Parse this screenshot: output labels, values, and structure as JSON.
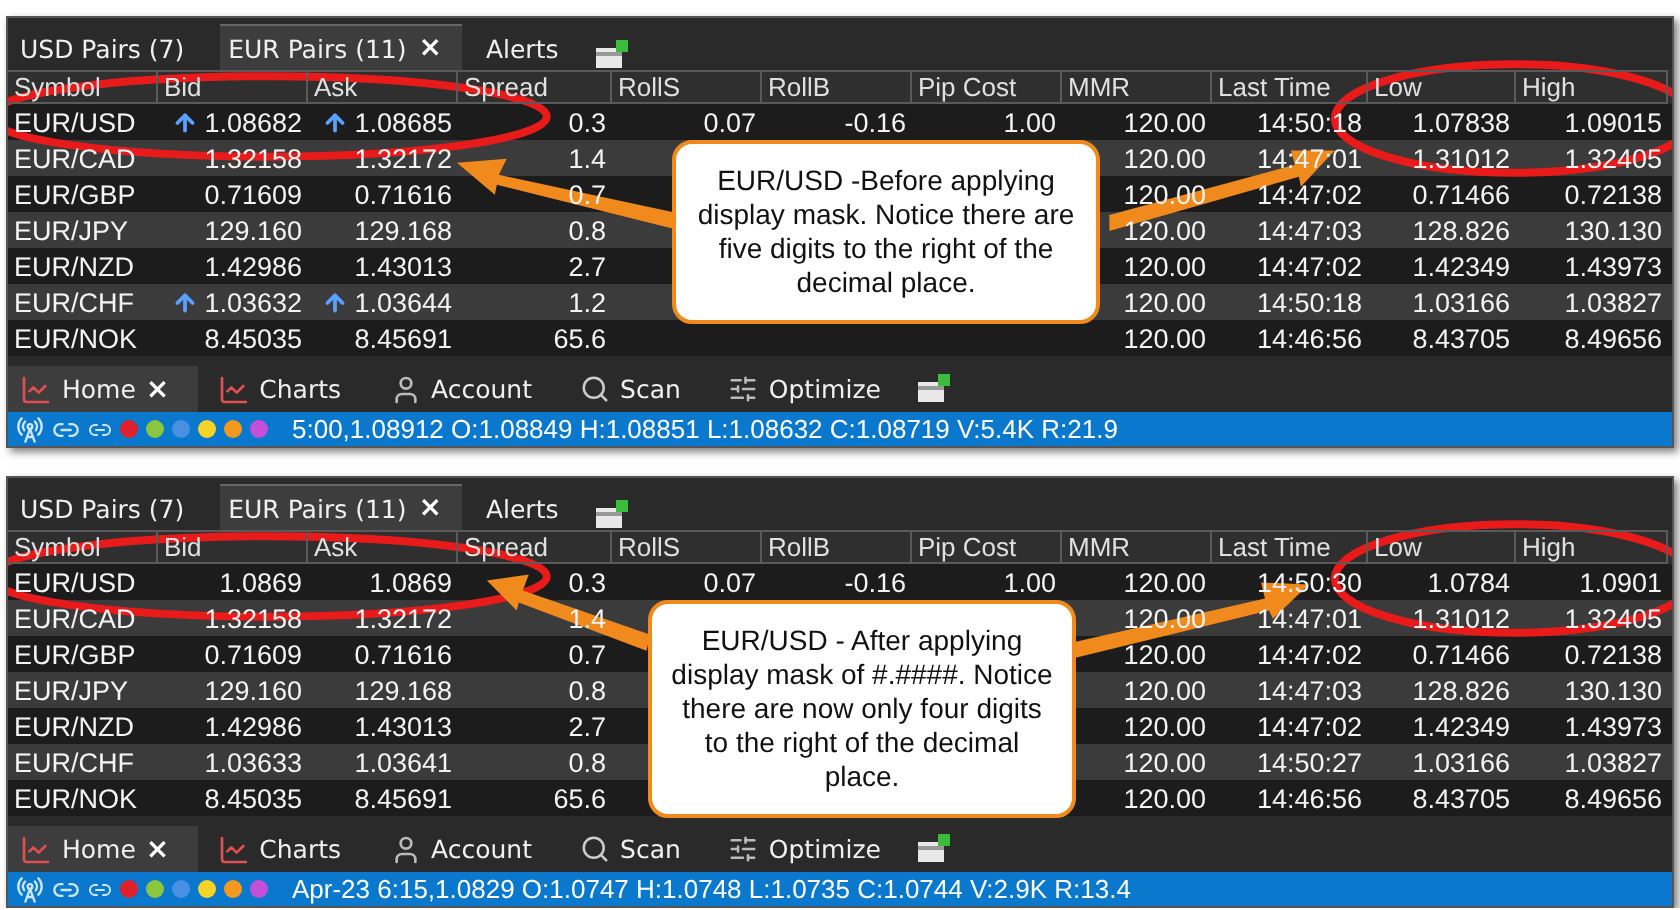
{
  "panels": [
    {
      "tabs": [
        {
          "label": "USD Pairs (7)",
          "selected": false
        },
        {
          "label": "EUR Pairs (11)",
          "selected": true,
          "close": "×"
        },
        {
          "label": "Alerts",
          "selected": false
        }
      ],
      "columns": [
        "Symbol",
        "Bid",
        "Ask",
        "Spread",
        "RollS",
        "RollB",
        "Pip Cost",
        "MMR",
        "Last Time",
        "Low",
        "High"
      ],
      "rows": [
        {
          "cells": [
            "EUR/USD",
            "1.08682",
            "1.08685",
            "0.3",
            "0.07",
            "-0.16",
            "1.00",
            "120.00",
            "14:50:18",
            "1.07838",
            "1.09015"
          ],
          "bid_up": true,
          "ask_up": true
        },
        {
          "cells": [
            "EUR/CAD",
            "1.32158",
            "1.32172",
            "1.4",
            null,
            null,
            null,
            "120.00",
            "14:47:01",
            "1.31012",
            "1.32405"
          ],
          "bid_up": false,
          "ask_up": false
        },
        {
          "cells": [
            "EUR/GBP",
            "0.71609",
            "0.71616",
            "0.7",
            null,
            null,
            null,
            "120.00",
            "14:47:02",
            "0.71466",
            "0.72138"
          ],
          "bid_up": false,
          "ask_up": false
        },
        {
          "cells": [
            "EUR/JPY",
            "129.160",
            "129.168",
            "0.8",
            null,
            null,
            null,
            "120.00",
            "14:47:03",
            "128.826",
            "130.130"
          ],
          "bid_up": false,
          "ask_up": false
        },
        {
          "cells": [
            "EUR/NZD",
            "1.42986",
            "1.43013",
            "2.7",
            null,
            null,
            null,
            "120.00",
            "14:47:02",
            "1.42349",
            "1.43973"
          ],
          "bid_up": false,
          "ask_up": false
        },
        {
          "cells": [
            "EUR/CHF",
            "1.03632",
            "1.03644",
            "1.2",
            null,
            null,
            null,
            "120.00",
            "14:50:18",
            "1.03166",
            "1.03827"
          ],
          "bid_up": true,
          "ask_up": true
        },
        {
          "cells": [
            "EUR/NOK",
            "8.45035",
            "8.45691",
            "65.6",
            null,
            null,
            null,
            "120.00",
            "14:46:56",
            "8.43705",
            "8.49656"
          ],
          "bid_up": false,
          "ask_up": false
        }
      ],
      "bottom_tabs": [
        {
          "label": "Home",
          "selected": true,
          "close": "×",
          "kind": "home"
        },
        {
          "label": "Charts",
          "selected": false,
          "kind": "charts"
        },
        {
          "label": "Account",
          "selected": false,
          "kind": "account"
        },
        {
          "label": "Scan",
          "selected": false,
          "kind": "scan"
        },
        {
          "label": "Optimize",
          "selected": false,
          "kind": "optimize"
        }
      ],
      "status_dots": [
        {
          "color": "#e0202a"
        },
        {
          "color": "#8cc63f"
        },
        {
          "color": "#4a90e2"
        },
        {
          "color": "#f5d327"
        },
        {
          "color": "#f39a1e"
        },
        {
          "color": "#c44fd8"
        }
      ],
      "status_text": "5:00,1.08912 O:1.08849 H:1.08851 L:1.08632 C:1.08719 V:5.4K R:21.9",
      "callout": {
        "text": "EUR/USD -Before applying display mask.  Notice there are five digits to the right of the decimal place."
      }
    },
    {
      "tabs": [
        {
          "label": "USD Pairs (7)",
          "selected": false
        },
        {
          "label": "EUR Pairs (11)",
          "selected": true,
          "close": "×"
        },
        {
          "label": "Alerts",
          "selected": false
        }
      ],
      "columns": [
        "Symbol",
        "Bid",
        "Ask",
        "Spread",
        "RollS",
        "RollB",
        "Pip Cost",
        "MMR",
        "Last Time",
        "Low",
        "High"
      ],
      "rows": [
        {
          "cells": [
            "EUR/USD",
            "1.0869",
            "1.0869",
            "0.3",
            "0.07",
            "-0.16",
            "1.00",
            "120.00",
            "14:50:30",
            "1.0784",
            "1.0901"
          ],
          "bid_up": false,
          "ask_up": false
        },
        {
          "cells": [
            "EUR/CAD",
            "1.32158",
            "1.32172",
            "1.4",
            null,
            null,
            null,
            "120.00",
            "14:47:01",
            "1.31012",
            "1.32405"
          ],
          "bid_up": false,
          "ask_up": false
        },
        {
          "cells": [
            "EUR/GBP",
            "0.71609",
            "0.71616",
            "0.7",
            null,
            null,
            null,
            "120.00",
            "14:47:02",
            "0.71466",
            "0.72138"
          ],
          "bid_up": false,
          "ask_up": false
        },
        {
          "cells": [
            "EUR/JPY",
            "129.160",
            "129.168",
            "0.8",
            null,
            null,
            null,
            "120.00",
            "14:47:03",
            "128.826",
            "130.130"
          ],
          "bid_up": false,
          "ask_up": false
        },
        {
          "cells": [
            "EUR/NZD",
            "1.42986",
            "1.43013",
            "2.7",
            null,
            null,
            null,
            "120.00",
            "14:47:02",
            "1.42349",
            "1.43973"
          ],
          "bid_up": false,
          "ask_up": false
        },
        {
          "cells": [
            "EUR/CHF",
            "1.03633",
            "1.03641",
            "0.8",
            null,
            null,
            null,
            "120.00",
            "14:50:27",
            "1.03166",
            "1.03827"
          ],
          "bid_up": false,
          "ask_up": false
        },
        {
          "cells": [
            "EUR/NOK",
            "8.45035",
            "8.45691",
            "65.6",
            null,
            null,
            null,
            "120.00",
            "14:46:56",
            "8.43705",
            "8.49656"
          ],
          "bid_up": false,
          "ask_up": false
        }
      ],
      "bottom_tabs": [
        {
          "label": "Home",
          "selected": true,
          "close": "×",
          "kind": "home"
        },
        {
          "label": "Charts",
          "selected": false,
          "kind": "charts"
        },
        {
          "label": "Account",
          "selected": false,
          "kind": "account"
        },
        {
          "label": "Scan",
          "selected": false,
          "kind": "scan"
        },
        {
          "label": "Optimize",
          "selected": false,
          "kind": "optimize"
        }
      ],
      "status_dots": [
        {
          "color": "#e0202a"
        },
        {
          "color": "#8cc63f"
        },
        {
          "color": "#4a90e2"
        },
        {
          "color": "#f5d327"
        },
        {
          "color": "#f39a1e"
        },
        {
          "color": "#c44fd8"
        }
      ],
      "status_text": "Apr-23 6:15,1.0829 O:1.0747 H:1.0748 L:1.0735 C:1.0744 V:2.9K R:13.4",
      "callout": {
        "text": "EUR/USD - After applying display mask of #.####. Notice there are now only four digits to the right of the decimal place."
      }
    }
  ]
}
